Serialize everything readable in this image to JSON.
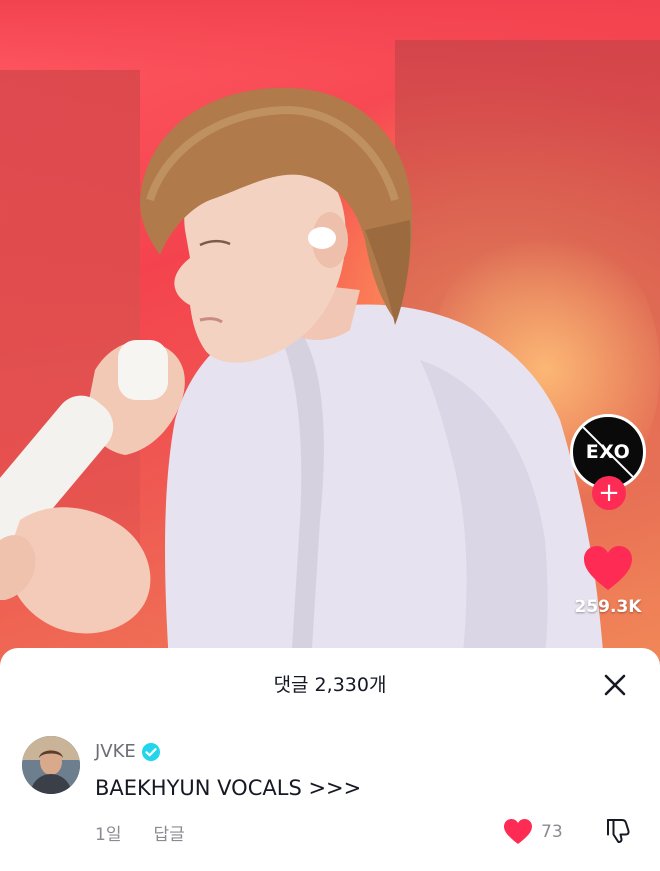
{
  "video": {
    "channel_avatar_text": "EXO",
    "follow_symbol": "+",
    "like_count": "259.3K",
    "colors": {
      "like_heart": "#fe2c55",
      "background_red": "#f4434e"
    }
  },
  "comments_sheet": {
    "title": "댓글 2,330개",
    "close_icon": "close-icon",
    "comments": [
      {
        "username": "JVKE",
        "verified": true,
        "text": "BAEKHYUN VOCALS >>>",
        "age": "1일",
        "reply_label": "답글",
        "like_count": "73",
        "liked": true
      }
    ]
  }
}
